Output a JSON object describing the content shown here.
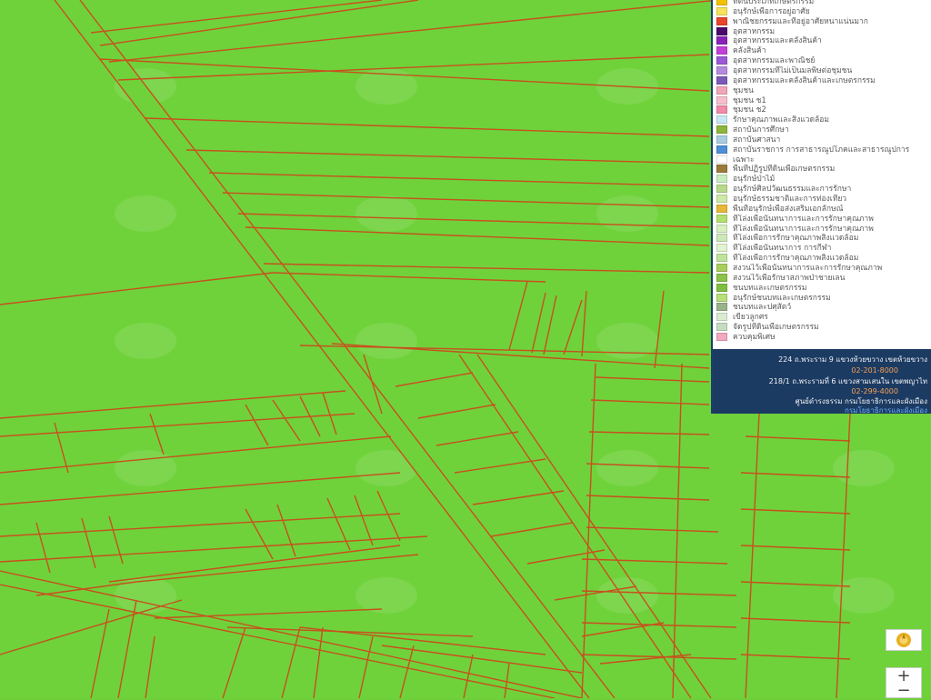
{
  "map": {
    "base_color": "#6fd23a",
    "parcel_line_color": "#c8501e",
    "watermark_color": "rgba(255,255,255,0.10)"
  },
  "legend": {
    "items": [
      {
        "label": "ที่ดินประเภทเกษตรกรรม",
        "color": "#f2c200"
      },
      {
        "label": "อนุรักษ์เพื่อการอยู่อาศัย",
        "color": "#f7e25c"
      },
      {
        "label": "พาณิชยกรรมและที่อยู่อาศัยหนาแน่นมาก",
        "color": "#e8452c"
      },
      {
        "label": "อุตสาหกรรม",
        "color": "#4a0a6b"
      },
      {
        "label": "อุตสาหกรรมและคลังสินค้า",
        "color": "#8a22b8"
      },
      {
        "label": "คลังสินค้า",
        "color": "#c23fd8"
      },
      {
        "label": "อุตสาหกรรมและพาณิชย์",
        "color": "#9b58d6"
      },
      {
        "label": "อุตสาหกรรมที่ไม่เป็นมลพิษต่อชุมชน",
        "color": "#b48ae0"
      },
      {
        "label": "อุตสาหกรรมและคลังสินค้าและเกษตรกรรม",
        "color": "#7b5bb8"
      },
      {
        "label": "ชุมชน",
        "color": "#f2a6b8"
      },
      {
        "label": "ชุมชน ช1",
        "color": "#f6bfcd"
      },
      {
        "label": "ชุมชน ช2",
        "color": "#f08aa6"
      },
      {
        "label": "รักษาคุณภาพและสิ่งแวดล้อม",
        "color": "#c7e8f4"
      },
      {
        "label": "สถาบันการศึกษา",
        "color": "#8db63a"
      },
      {
        "label": "สถาบันศาสนา",
        "color": "#a9cde0"
      },
      {
        "label": "สถาบันราชการ การสาธารณูปโภคและสาธารณูปการ",
        "color": "#4d8fd6"
      },
      {
        "label": "เฉพาะ",
        "color": "#ffffff"
      },
      {
        "label": "พื้นที่ปฏิรูปที่ดินเพื่อเกษตรกรรม",
        "color": "#9a7b3c"
      },
      {
        "label": "อนุรักษ์ป่าไม้",
        "color": "#c9ecc0"
      },
      {
        "label": "อนุรักษ์ศิลปวัฒนธรรมและการรักษา",
        "color": "#b9d98a"
      },
      {
        "label": "อนุรักษ์ธรรมชาติและการท่องเที่ยว",
        "color": "#cfe9a6"
      },
      {
        "label": "พื้นที่อนุรักษ์เพื่อส่งเสริมเอกลักษณ์",
        "color": "#e6b83a"
      },
      {
        "label": "ที่โล่งเพื่อนันทนาการและการรักษาคุณภาพ",
        "color": "#b3e06d"
      },
      {
        "label": "ที่โล่งเพื่อนันทนาการและการรักษาคุณภาพ",
        "color": "#d8efc0"
      },
      {
        "label": "ที่โล่งเพื่อการรักษาคุณภาพสิ่งแวดล้อม",
        "color": "#cde8b8"
      },
      {
        "label": "ที่โล่งเพื่อนันทนาการ การกีฬา",
        "color": "#e2f3cf"
      },
      {
        "label": "ที่โล่งเพื่อการรักษาคุณภาพสิ่งแวดล้อม",
        "color": "#bfe39a"
      },
      {
        "label": "สงวนไว้เพื่อนันทนาการและการรักษาคุณภาพ",
        "color": "#a8cf5c"
      },
      {
        "label": "สงวนไว้เพื่อรักษาสภาพป่าชายเลน",
        "color": "#8cc24a"
      },
      {
        "label": "ชนบทและเกษตรกรรม",
        "color": "#7fbf3f"
      },
      {
        "label": "อนุรักษ์ชนบทและเกษตรกรรม",
        "color": "#b7df7a"
      },
      {
        "label": "ชนบทและปศุสัตว์",
        "color": "#98b38a"
      },
      {
        "label": "เขียวลูกศร",
        "color": "#d9ecd0"
      },
      {
        "label": "จัดรูปที่ดินเพื่อเกษตรกรรม",
        "color": "#c4dcc0"
      },
      {
        "label": "ควบคุมพิเศษ",
        "color": "#f2a8bf"
      }
    ]
  },
  "contact": {
    "address1": "224 ถ.พระราม 9 แขวงห้วยขวาง เขตห้วยขวาง",
    "phone1": "02-201-8000",
    "address2": "218/1 ถ.พระรามที่ 6 แขวงสามเสนใน เขตพญาไท",
    "phone2": "02-299-4000",
    "office": "ศูนย์ดำรงธรรม กรมโยธาธิการและผังเมือง",
    "link": "กรมโยธาธิการและผังเมือง"
  },
  "controls": {
    "zoom_in": "+",
    "zoom_out": "−",
    "layer_icon": "layer-logo-icon"
  }
}
